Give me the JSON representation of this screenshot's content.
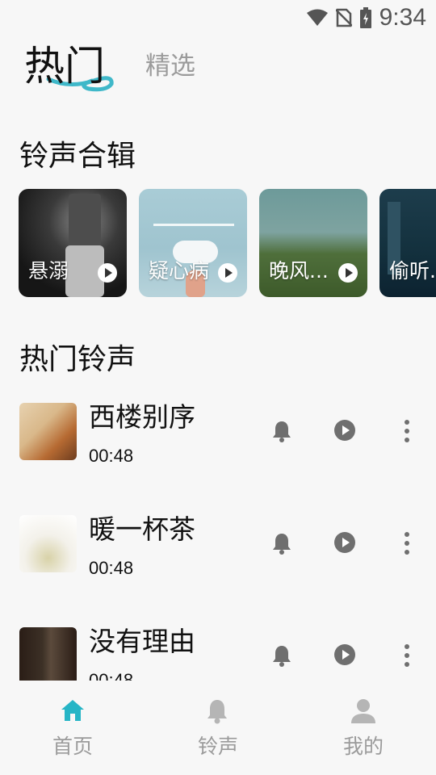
{
  "status_bar": {
    "time": "9:34",
    "icons": [
      "wifi-icon",
      "no-sim-icon",
      "battery-charging-icon"
    ]
  },
  "header": {
    "tabs": [
      {
        "label": "热门",
        "active": true
      },
      {
        "label": "精选",
        "active": false
      }
    ],
    "accent_color": "#3fb8c9"
  },
  "albums_section": {
    "title": "铃声合辑",
    "items": [
      {
        "title": "悬溺",
        "icon": "play-circle-icon"
      },
      {
        "title": "疑心病",
        "icon": "play-circle-icon"
      },
      {
        "title": "晚风...",
        "icon": "play-circle-icon"
      },
      {
        "title": "偷听...",
        "icon": "play-circle-icon"
      }
    ]
  },
  "ringtones_section": {
    "title": "热门铃声",
    "items": [
      {
        "name": "西楼别序",
        "duration": "00:48"
      },
      {
        "name": "暖一杯茶",
        "duration": "00:48"
      },
      {
        "name": "没有理由",
        "duration": "00:48"
      }
    ],
    "action_icons": [
      "bell-icon",
      "play-circle-icon",
      "more-vert-icon"
    ]
  },
  "bottom_nav": {
    "items": [
      {
        "label": "首页",
        "icon": "home-icon",
        "active": true
      },
      {
        "label": "铃声",
        "icon": "bell-icon",
        "active": false
      },
      {
        "label": "我的",
        "icon": "person-icon",
        "active": false
      }
    ],
    "active_color": "#26b5c6",
    "inactive_color": "#b5b5b5"
  }
}
